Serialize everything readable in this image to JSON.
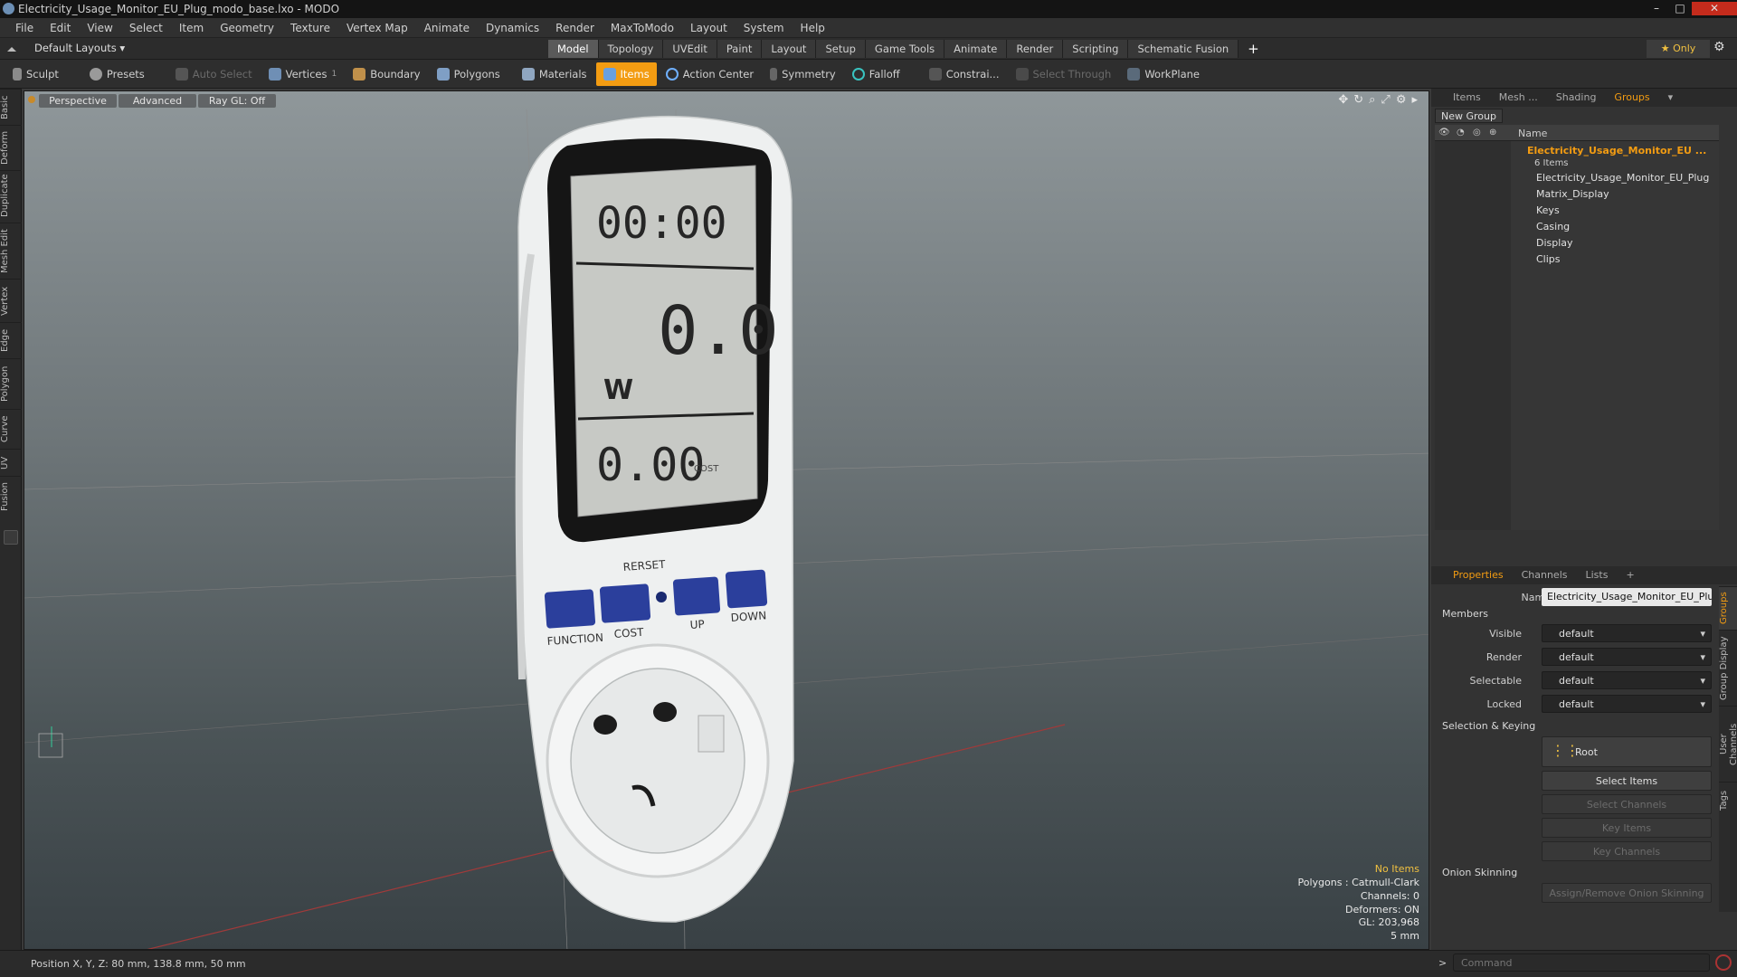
{
  "window": {
    "title": "Electricity_Usage_Monitor_EU_Plug_modo_base.lxo - MODO",
    "controls": [
      "–",
      "□",
      "✕"
    ]
  },
  "menu": [
    "File",
    "Edit",
    "View",
    "Select",
    "Item",
    "Geometry",
    "Texture",
    "Vertex Map",
    "Animate",
    "Dynamics",
    "Render",
    "MaxToModo",
    "Layout",
    "System",
    "Help"
  ],
  "layouts": {
    "label": "Default Layouts ▾",
    "tabs": [
      "Model",
      "Topology",
      "UVEdit",
      "Paint",
      "Layout",
      "Setup",
      "Game Tools",
      "Animate",
      "Render",
      "Scripting",
      "Schematic Fusion"
    ],
    "active": "Model",
    "add": "+",
    "only": "★  Only"
  },
  "toolbar": {
    "sculpt": "Sculpt",
    "presets": "Presets",
    "auto_select": "Auto Select",
    "vertices": "Vertices",
    "vcount": "1",
    "boundary": "Boundary",
    "polygons": "Polygons",
    "materials": "Materials",
    "items": "Items",
    "action_center": "Action Center",
    "symmetry": "Symmetry",
    "falloff": "Falloff",
    "constraints": "Constrai...",
    "select_through": "Select Through",
    "workplane": "WorkPlane"
  },
  "left_tabs": [
    "Basic",
    "Deform",
    "Duplicate",
    "Mesh Edit",
    "Vertex",
    "Edge",
    "Polygon",
    "Curve",
    "UV",
    "Fusion"
  ],
  "viewport": {
    "view": "Perspective",
    "shading": "Advanced",
    "raygl": "Ray GL: Off",
    "info": [
      "No Items",
      "Polygons : Catmull-Clark",
      "Channels: 0",
      "Deformers: ON",
      "GL: 203,968",
      "5 mm"
    ],
    "lcd": {
      "time": "00:00",
      "main": "0.0",
      "unit": "W",
      "cost_value": "0.00",
      "cost_label": "COST"
    },
    "buttons": [
      "FUNCTION",
      "COST",
      "UP",
      "DOWN"
    ],
    "reset": "RERSET"
  },
  "status": {
    "position": "Position X, Y, Z:  80 mm, 138.8 mm, 50 mm"
  },
  "right": {
    "tabs": [
      "Items",
      "Mesh ...",
      "Shading",
      "Groups"
    ],
    "active": "Groups",
    "new_group": "New Group",
    "name_header": "Name",
    "group_name": "Electricity_Usage_Monitor_EU ...",
    "group_count": "6 Items",
    "items": [
      "Electricity_Usage_Monitor_EU_Plug",
      "Matrix_Display",
      "Keys",
      "Casing",
      "Display",
      "Clips"
    ],
    "prop_tabs": [
      "Properties",
      "Channels",
      "Lists",
      "+"
    ],
    "name_label": "Name",
    "name_value": "Electricity_Usage_Monitor_EU_Plug (",
    "members": "Members",
    "props": [
      {
        "label": "Visible",
        "value": "default"
      },
      {
        "label": "Render",
        "value": "default"
      },
      {
        "label": "Selectable",
        "value": "default"
      },
      {
        "label": "Locked",
        "value": "default"
      }
    ],
    "sel_keying": "Selection & Keying",
    "root": "Root",
    "select_items": "Select Items",
    "select_channels": "Select Channels",
    "key_items": "Key Items",
    "key_channels": "Key Channels",
    "onion": "Onion Skinning",
    "onion_btn": "Assign/Remove Onion Skinning",
    "side_tabs": [
      "Groups",
      "Group Display",
      "User Channels",
      "Tags"
    ],
    "command_prompt": ">",
    "command_placeholder": "Command"
  },
  "colors": {
    "accent": "#f39c12",
    "button_blue": "#2b3f9c"
  }
}
